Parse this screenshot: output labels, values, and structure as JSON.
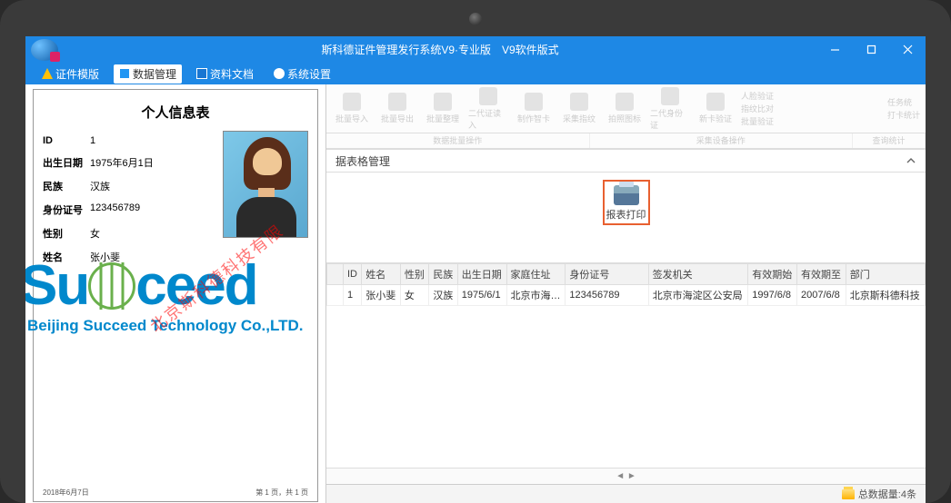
{
  "window": {
    "title": "斯科德证件管理发行系统V9·专业版　V9软件版式"
  },
  "menu": {
    "items": [
      {
        "label": "证件模版"
      },
      {
        "label": "数据管理"
      },
      {
        "label": "资料文档"
      },
      {
        "label": "系统设置"
      }
    ]
  },
  "ribbon": {
    "buttons": [
      "批量导入",
      "批量导出",
      "批量整理",
      "二代证读入",
      "制作智卡",
      "采集指纹",
      "拍照图标",
      "二代身份证",
      "新卡验证"
    ],
    "rightbox": [
      "人脸验证",
      "指纹比对",
      "批量验证"
    ],
    "taskstat": [
      "任务统",
      "打卡统计"
    ],
    "groups": [
      "数据批量操作",
      "采集设备操作",
      "查询统计"
    ]
  },
  "doc": {
    "title": "个人信息表",
    "fields": {
      "id_label": "ID",
      "id": "1",
      "dob_label": "出生日期",
      "dob": "1975年6月1日",
      "ethnic_label": "民族",
      "ethnic": "汉族",
      "idno_label": "身份证号",
      "idno": "123456789",
      "sex_label": "性别",
      "sex": "女",
      "name_label": "姓名",
      "name": "张小斐"
    },
    "footer_left": "2018年6月7日",
    "footer_right": "第 1 页，共 1 页",
    "watermark_main": "Su",
    "watermark_main2": "ceed",
    "watermark_sub": "Beijing Succeed Technology Co.,LTD.",
    "watermark_diag": "北京斯科德科技有限"
  },
  "section": {
    "title": "据表格管理"
  },
  "printbtn": {
    "label": "报表打印"
  },
  "grid": {
    "headers": [
      "",
      "ID",
      "姓名",
      "性别",
      "民族",
      "出生日期",
      "家庭住址",
      "身份证号",
      "签发机关",
      "有效期始",
      "有效期至",
      "部门"
    ],
    "rows": [
      [
        "",
        "1",
        "张小斐",
        "女",
        "汉族",
        "1975/6/1",
        "北京市海…",
        "123456789",
        "北京市海淀区公安局",
        "1997/6/8",
        "2007/6/8",
        "北京斯科德科技"
      ]
    ]
  },
  "status": {
    "total": "总数据量:4条"
  }
}
